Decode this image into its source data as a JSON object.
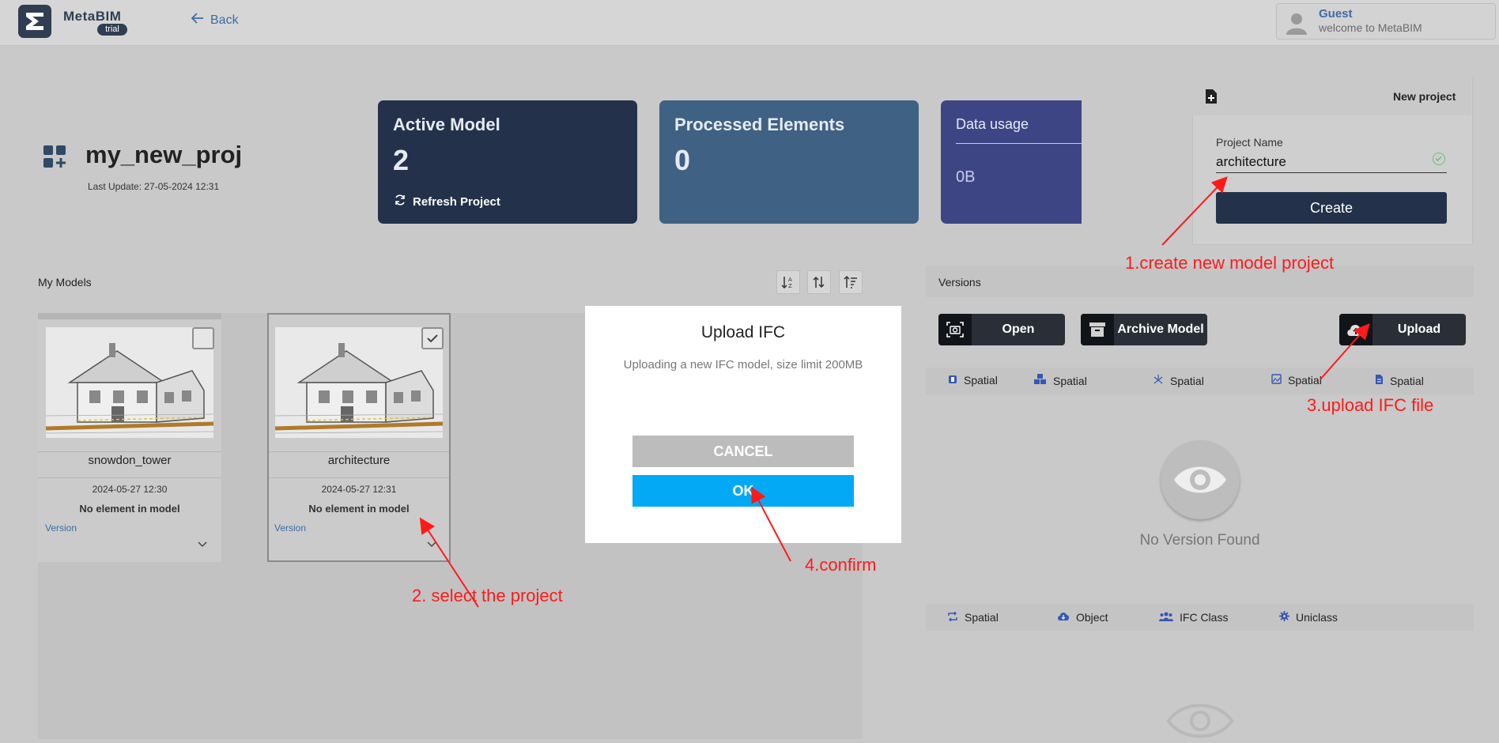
{
  "app": {
    "brand": "MetaBIM",
    "badge": "trial",
    "back_label": "Back"
  },
  "user": {
    "name": "Guest",
    "subtitle": "welcome to MetaBIM"
  },
  "project": {
    "title": "my_new_proj",
    "last_update": "Last Update: 27-05-2024 12:31"
  },
  "stats": {
    "active_model": {
      "title": "Active Model",
      "value": "2",
      "action": "Refresh Project"
    },
    "processed": {
      "title": "Processed Elements",
      "value": "0"
    },
    "data_usage": {
      "title": "Data usage",
      "value": "0B"
    }
  },
  "new_project": {
    "header": "New project",
    "field_label": "Project Name",
    "field_value": "architecture",
    "create_label": "Create"
  },
  "models": {
    "label": "My Models",
    "items": [
      {
        "name": "snowdon_tower",
        "date": "2024-05-27 12:30",
        "status": "No element in model",
        "version_label": "Version",
        "selected": false
      },
      {
        "name": "architecture",
        "date": "2024-05-27 12:31",
        "status": "No element in model",
        "version_label": "Version",
        "selected": true
      }
    ]
  },
  "dialog": {
    "title": "Upload IFC",
    "message": "Uploading a new IFC model, size limit 200MB",
    "cancel_label": "CANCEL",
    "ok_label": "OK"
  },
  "versions": {
    "label": "Versions",
    "open_label": "Open",
    "archive_label": "Archive Model",
    "upload_label": "Upload",
    "tabs_top": [
      "Spatial",
      "Spatial",
      "Spatial",
      "Spatial",
      "Spatial"
    ],
    "empty_text": "No Version Found",
    "tabs_bottom": [
      "Spatial",
      "Object",
      "IFC Class",
      "Uniclass"
    ]
  },
  "annotations": {
    "step1": "1.create new model project",
    "step2": "2. select the project",
    "step3": "3.upload IFC file",
    "step4": "4.confirm"
  },
  "colors": {
    "dark_card": "#23324a",
    "blue_card": "#3f6184",
    "purple_card": "#3e4585",
    "ok_button": "#03a9f4",
    "annotation": "#ff1a1a"
  }
}
